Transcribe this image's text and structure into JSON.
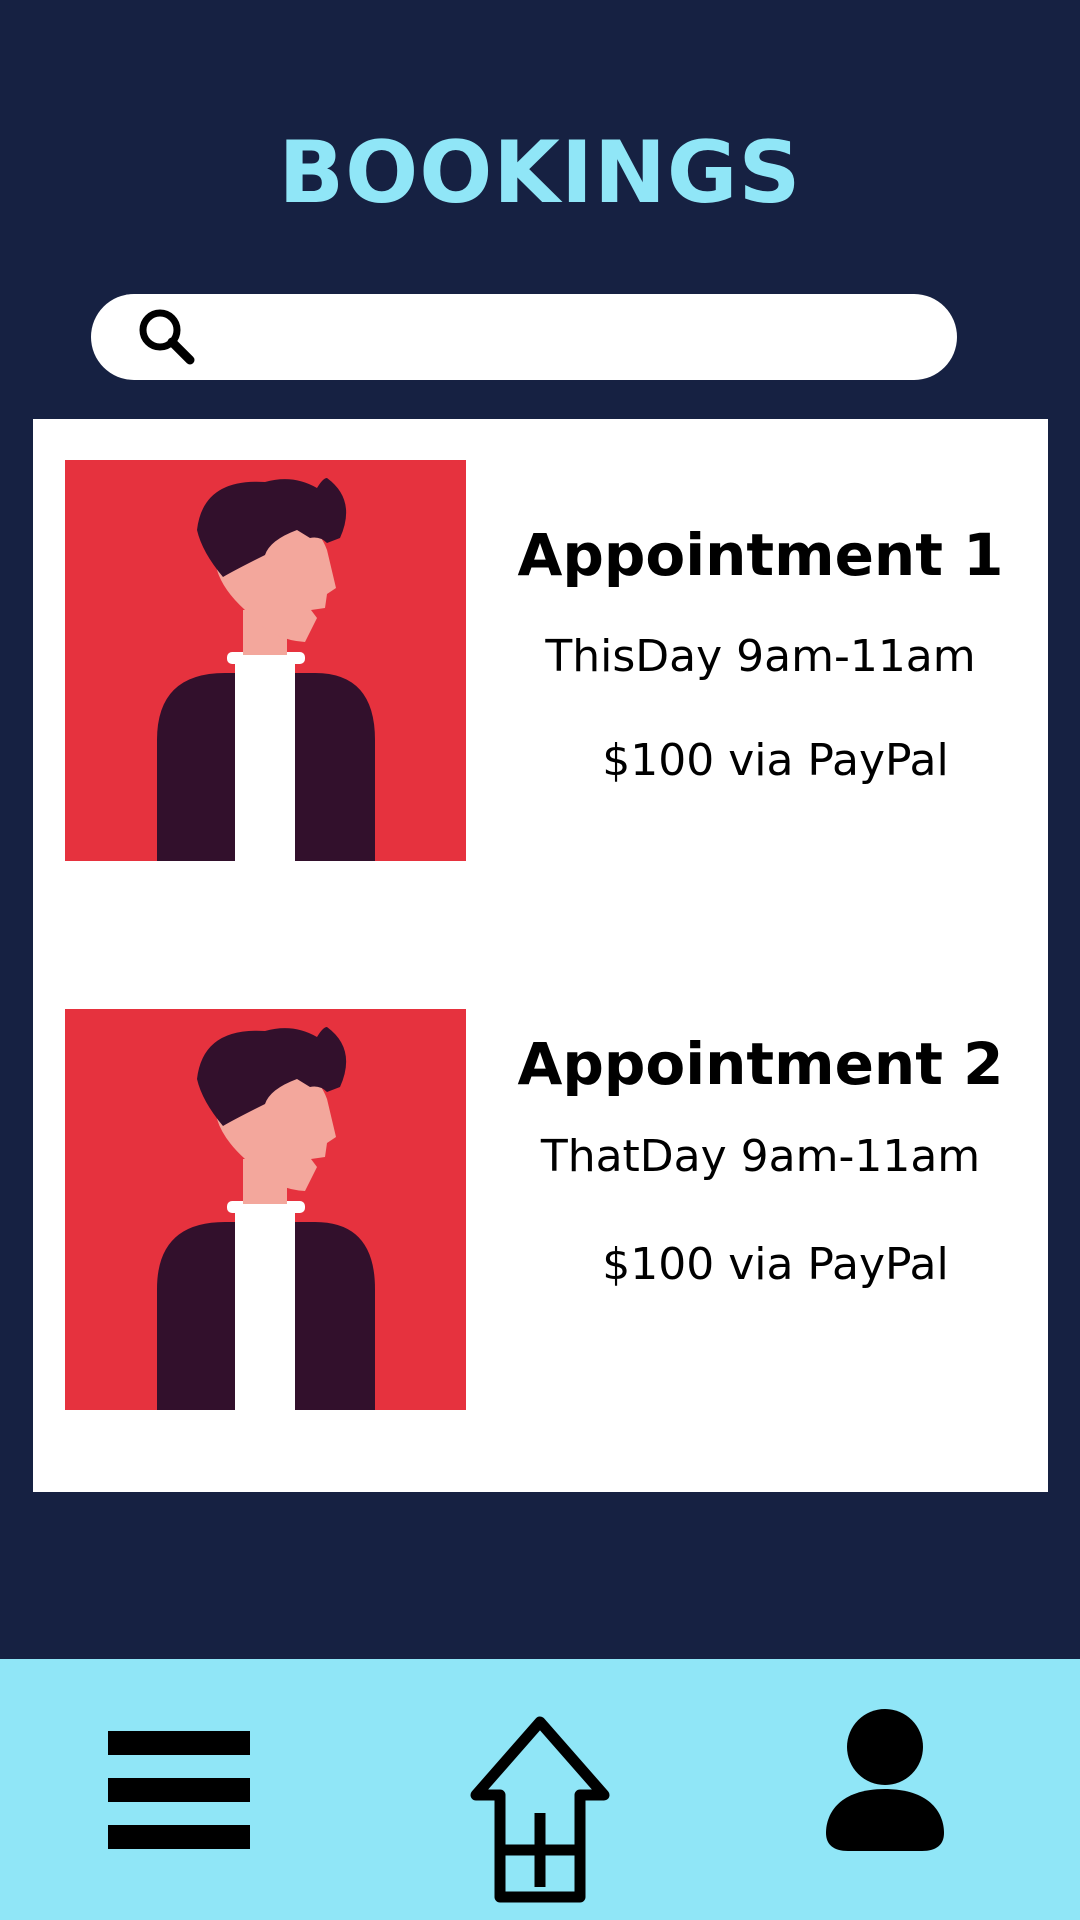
{
  "header": {
    "title": "BOOKINGS"
  },
  "search": {
    "placeholder": "",
    "value": "",
    "icon": "search-icon"
  },
  "appointments": [
    {
      "title": "Appointment 1",
      "time": "ThisDay 9am-11am",
      "price": "$100 via PayPal",
      "avatar": "person-avatar"
    },
    {
      "title": "Appointment 2",
      "time": "ThatDay 9am-11am",
      "price": "$100 via PayPal",
      "avatar": "person-avatar"
    }
  ],
  "bottom_nav": {
    "items": [
      {
        "icon": "menu-icon"
      },
      {
        "icon": "add-home-icon"
      },
      {
        "icon": "profile-icon"
      }
    ]
  },
  "colors": {
    "background": "#162142",
    "accent": "#90e6f7",
    "panel": "#ffffff",
    "avatar_background": "#e6323e",
    "hair_and_jacket": "#32102c",
    "skin": "#f3a79c",
    "shirt": "#ffffff"
  }
}
